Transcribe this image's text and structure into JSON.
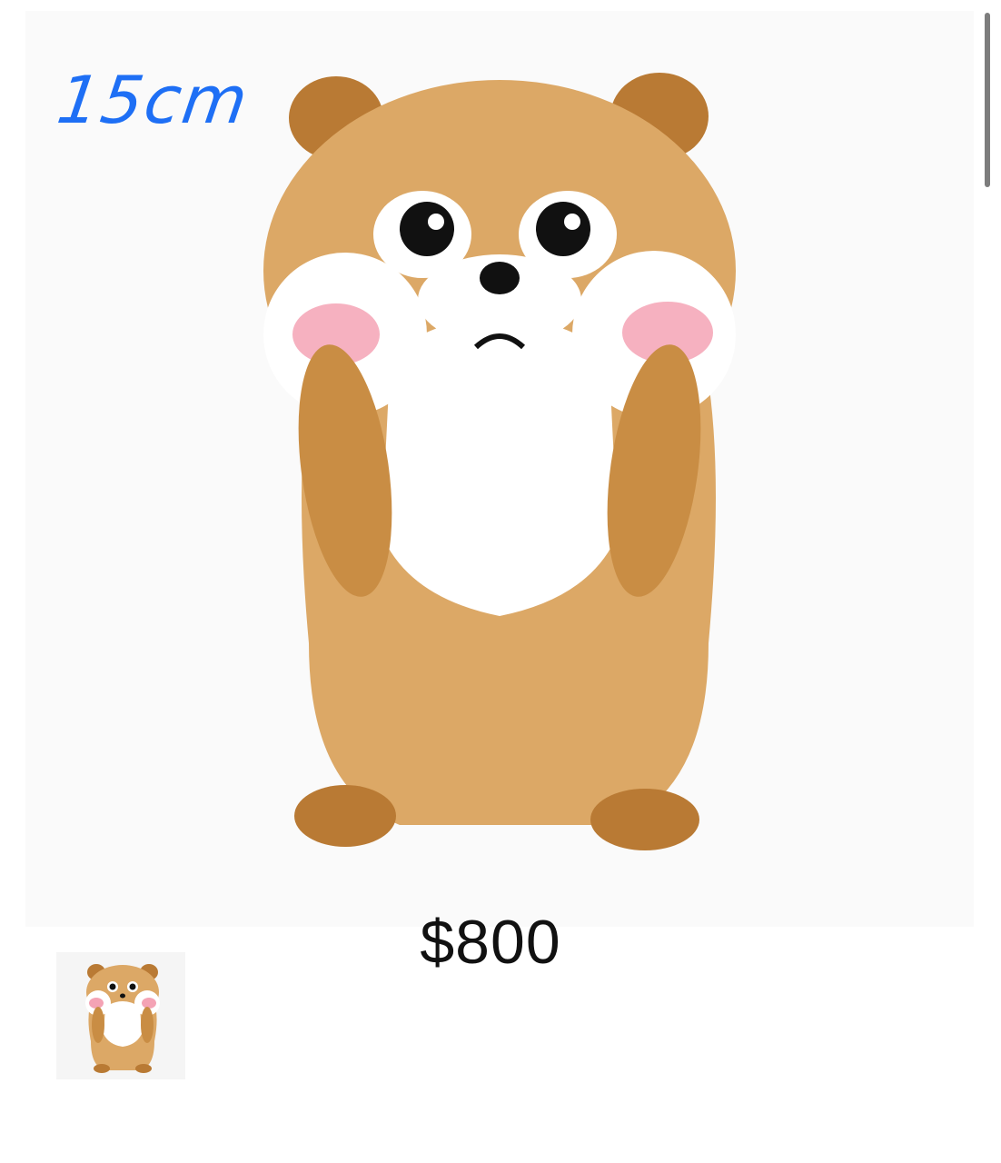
{
  "product": {
    "size_note": "15cm",
    "price": "$800",
    "image_subject": "hamster-plush-icon"
  },
  "colors": {
    "fur": "#dca866",
    "fur_dark": "#b97a34",
    "belly": "#ffffff",
    "blush": "#f4a3b5",
    "size_note": "#1e6ff5"
  }
}
